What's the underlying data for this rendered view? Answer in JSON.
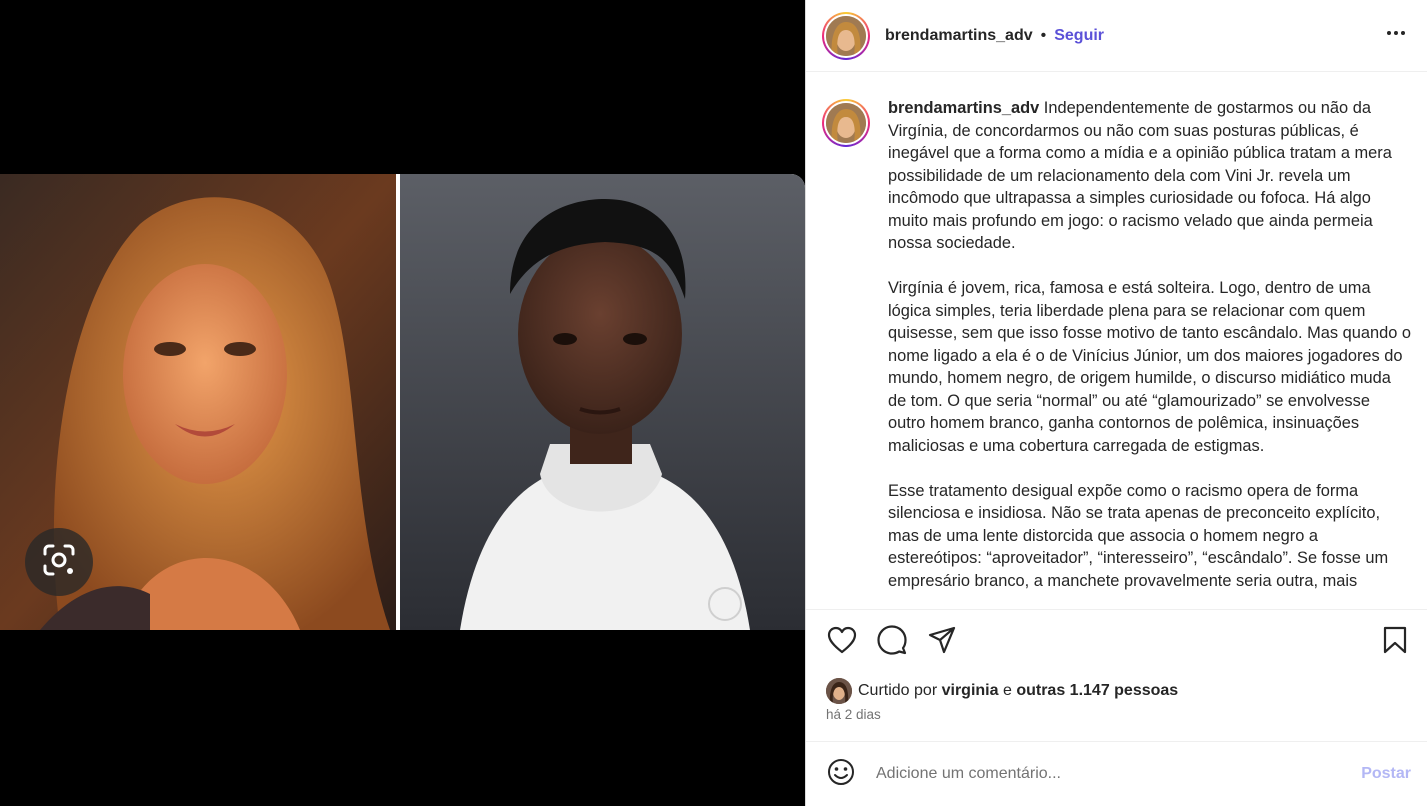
{
  "post": {
    "username": "brendamartins_adv",
    "dot": "•",
    "follow_label": "Seguir",
    "caption": {
      "username": "brendamartins_adv",
      "paragraphs": [
        "Independentemente de gostarmos ou não da Virgínia, de concordarmos ou não com suas posturas públicas, é inegável que a forma como a mídia e a opinião pública tratam a mera possibilidade de um relacionamento dela com Vini Jr. revela um incômodo que ultrapassa a simples curiosidade ou fofoca. Há algo muito mais profundo em jogo: o racismo velado que ainda permeia nossa sociedade.",
        "Virgínia é jovem, rica, famosa e está solteira. Logo, dentro de uma lógica simples, teria liberdade plena para se relacionar com quem quisesse, sem que isso fosse motivo de tanto escândalo. Mas quando o nome ligado a ela é o de Vinícius Júnior, um dos maiores jogadores do mundo, homem negro, de origem humilde, o discurso midiático muda de tom. O que seria “normal” ou até “glamourizado” se envolvesse outro homem branco, ganha contornos de polêmica, insinuações maliciosas e uma cobertura carregada de estigmas.",
        "Esse tratamento desigual expõe como o racismo opera de forma silenciosa e insidiosa. Não se trata apenas de preconceito explícito, mas de uma lente distorcida que associa o homem negro a estereótipos: “aproveitador”, “interesseiro”, “escândalo”. Se fosse um empresário branco, a manchete provavelmente seria outra, mais"
      ]
    },
    "likes": {
      "prefix": "Curtido por",
      "user": "virginia",
      "conjunction": "e",
      "others": "outras 1.147 pessoas"
    },
    "timestamp": "há 2 dias",
    "comment": {
      "placeholder": "Adicione um comentário...",
      "post_label": "Postar"
    }
  },
  "icons": {
    "lens": "google-lens-icon",
    "more": "more-options-icon",
    "like": "heart-icon",
    "comment": "comment-icon",
    "share": "share-icon",
    "save": "bookmark-icon",
    "emoji": "emoji-icon"
  },
  "colors": {
    "follow": "#5b51d8",
    "post_button_disabled": "#b3b7f5",
    "secondary_text": "#737373"
  }
}
